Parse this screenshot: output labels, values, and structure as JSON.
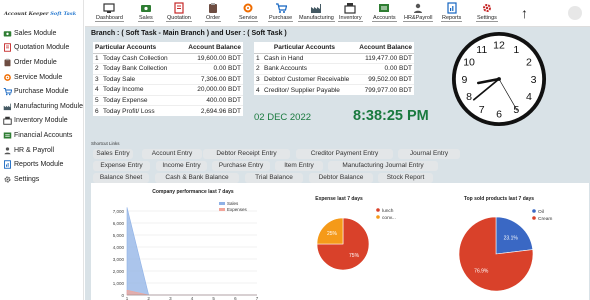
{
  "brand": {
    "title": "Account Keeper",
    "sub": "Soft Task"
  },
  "sidebar": {
    "items": [
      {
        "label": "Sales Module",
        "icon": "sales-icon",
        "color": "#2e7d32"
      },
      {
        "label": "Quotation Module",
        "icon": "quotation-icon",
        "color": "#c62828"
      },
      {
        "label": "Order Module",
        "icon": "order-icon",
        "color": "#6d4c41"
      },
      {
        "label": "Service Module",
        "icon": "service-icon",
        "color": "#ef6c00"
      },
      {
        "label": "Purchase Module",
        "icon": "purchase-icon",
        "color": "#1565c0"
      },
      {
        "label": "Manufacturing Module",
        "icon": "manufacturing-icon",
        "color": "#455a64"
      },
      {
        "label": "Inventory Module",
        "icon": "inventory-icon",
        "color": "#333333"
      },
      {
        "label": "Financial Accounts",
        "icon": "accounts-icon",
        "color": "#2e7d32"
      },
      {
        "label": "HR & Payroll",
        "icon": "hr-icon",
        "color": "#555555"
      },
      {
        "label": "Reports Module",
        "icon": "reports-icon",
        "color": "#1565c0"
      },
      {
        "label": "Settings",
        "icon": "settings-icon",
        "color": "#555555"
      }
    ]
  },
  "topnav": {
    "items": [
      {
        "label": "Dashboard",
        "icon": "dashboard-icon",
        "color": "#333333"
      },
      {
        "label": "Sales",
        "icon": "sales-icon",
        "color": "#2e7d32"
      },
      {
        "label": "Quotation",
        "icon": "quotation-icon",
        "color": "#c62828"
      },
      {
        "label": "Order",
        "icon": "order-icon",
        "color": "#6d4c41"
      },
      {
        "label": "Service",
        "icon": "service-icon",
        "color": "#ef6c00"
      },
      {
        "label": "Purchase",
        "icon": "purchase-icon",
        "color": "#1565c0"
      },
      {
        "label": "Manufacturing",
        "icon": "manufacturing-icon",
        "color": "#455a64"
      },
      {
        "label": "Inventory",
        "icon": "inventory-icon",
        "color": "#333333"
      },
      {
        "label": "Accounts",
        "icon": "accounts-icon",
        "color": "#2e7d32"
      },
      {
        "label": "HR&Payroll",
        "icon": "hr-icon",
        "color": "#555555"
      },
      {
        "label": "Reports",
        "icon": "reports-icon",
        "color": "#1565c0"
      },
      {
        "label": "Settings",
        "icon": "settings-icon",
        "color": "#c62828"
      }
    ]
  },
  "branch_line": "Branch : ( Soft Task - Main Branch ) and User : ( Soft Task )",
  "table_left": {
    "headers": [
      "Particular Accounts",
      "Account Balance"
    ],
    "rows": [
      {
        "idx": "1",
        "name": "Today Cash Collection",
        "value": "19,600.00 BDT"
      },
      {
        "idx": "2",
        "name": "Today Bank Collection",
        "value": "0.00 BDT"
      },
      {
        "idx": "3",
        "name": "Today Sale",
        "value": "7,306.00 BDT"
      },
      {
        "idx": "4",
        "name": "Today Income",
        "value": "20,000.00 BDT"
      },
      {
        "idx": "5",
        "name": "Today Expense",
        "value": "400.00 BDT"
      },
      {
        "idx": "6",
        "name": "Today Profit/ Loss",
        "value": "2,694.96 BDT"
      }
    ]
  },
  "table_right": {
    "headers": [
      "Particular Accounts",
      "Account Balance"
    ],
    "rows": [
      {
        "idx": "1",
        "name": "Cash in Hand",
        "value": "119,477.00 BDT"
      },
      {
        "idx": "2",
        "name": "Bank Accounts",
        "value": "0.00 BDT"
      },
      {
        "idx": "3",
        "name": "Debtor/ Customer Receivable",
        "value": "99,502.00 BDT"
      },
      {
        "idx": "4",
        "name": "Creditor/ Supplier Payable",
        "value": "799,977.00 BDT"
      }
    ]
  },
  "date": "02 DEC 2022",
  "time": "8:38:25 PM",
  "clock": {
    "hours": 8,
    "minutes": 38,
    "seconds": 25,
    "numerals": [
      "12",
      "1",
      "2",
      "3",
      "4",
      "5",
      "6",
      "7",
      "8",
      "9",
      "10",
      "11"
    ]
  },
  "shortcuts": {
    "title": "Shortcut Links",
    "rows": [
      [
        "Sales Entry",
        "Account Entry",
        "Debtor Receipt Entry",
        "Creditor Payment Entry",
        "Journal Entry"
      ],
      [
        "Expense Entry",
        "Income Entry",
        "Purchase Entry",
        "Item Entry",
        "Manufacturing Journal Entry"
      ],
      [
        "Balance Sheet",
        "Cash & Bank Balance",
        "Trial Balance",
        "Debtor Balance",
        "Stock Report"
      ]
    ]
  },
  "chart_data": [
    {
      "type": "area",
      "title": "Company performance last 7 days",
      "x": [
        1,
        2,
        3,
        4,
        5,
        6,
        7
      ],
      "series": [
        {
          "name": "Sales",
          "values": [
            7306,
            0,
            0,
            0,
            0,
            0,
            0
          ],
          "color": "#8fb1e6"
        },
        {
          "name": "Expenses",
          "values": [
            400,
            0,
            0,
            0,
            0,
            0,
            0
          ],
          "color": "#f2a59a"
        }
      ],
      "ylim": [
        0,
        8000
      ],
      "yticks": [
        "0",
        "1,000",
        "2,000",
        "3,000",
        "4,000",
        "5,000",
        "6,000",
        "7,000"
      ],
      "legend": "top-right"
    },
    {
      "type": "pie",
      "title": "Expense last 7 days",
      "slices": [
        {
          "name": "lunch",
          "value": 75,
          "label": "75%",
          "color": "#d9412a"
        },
        {
          "name": "conv...",
          "value": 25,
          "label": "25%",
          "color": "#f59a19"
        }
      ],
      "legend": "top-right"
    },
    {
      "type": "pie",
      "title": "Top sold products last 7 days",
      "slices": [
        {
          "name": "Oil",
          "value": 23.1,
          "label": "23.1%",
          "color": "#3a68c4"
        },
        {
          "name": "Cream",
          "value": 76.9,
          "label": "76.9%",
          "color": "#d9412a"
        }
      ],
      "legend": "top-right"
    }
  ]
}
